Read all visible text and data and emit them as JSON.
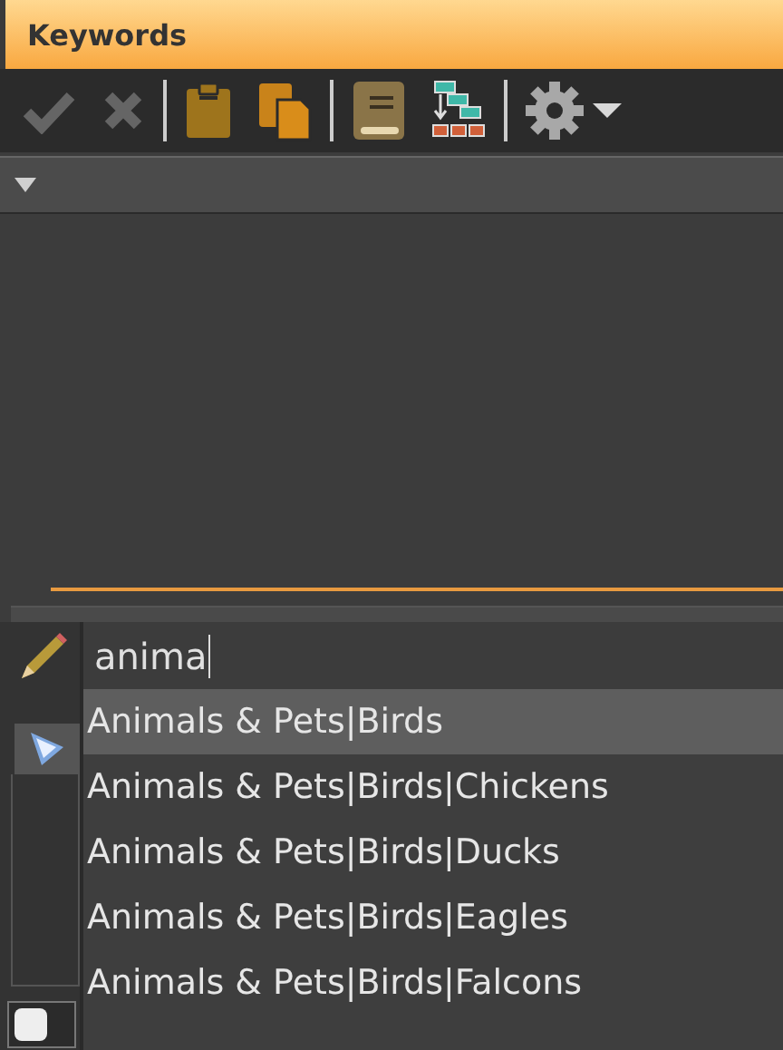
{
  "window": {
    "title": "Keywords"
  },
  "toolbar": [
    {
      "kind": "check",
      "disabled": true
    },
    {
      "kind": "cross",
      "disabled": true
    },
    {
      "kind": "separator"
    },
    {
      "kind": "clipboard",
      "disabled": false
    },
    {
      "kind": "copy",
      "disabled": false
    },
    {
      "kind": "separator"
    },
    {
      "kind": "book",
      "disabled": false
    },
    {
      "kind": "tree",
      "disabled": false
    },
    {
      "kind": "separator"
    },
    {
      "kind": "gear",
      "disabled": false
    }
  ],
  "search": {
    "value": "anima"
  },
  "suggestions": [
    {
      "label": "Animals & Pets|Birds",
      "selected": true
    },
    {
      "label": "Animals & Pets|Birds|Chickens",
      "selected": false
    },
    {
      "label": "Animals & Pets|Birds|Ducks",
      "selected": false
    },
    {
      "label": "Animals & Pets|Birds|Eagles",
      "selected": false
    },
    {
      "label": "Animals & Pets|Birds|Falcons",
      "selected": false
    }
  ],
  "checkbox": {
    "checked": false
  }
}
